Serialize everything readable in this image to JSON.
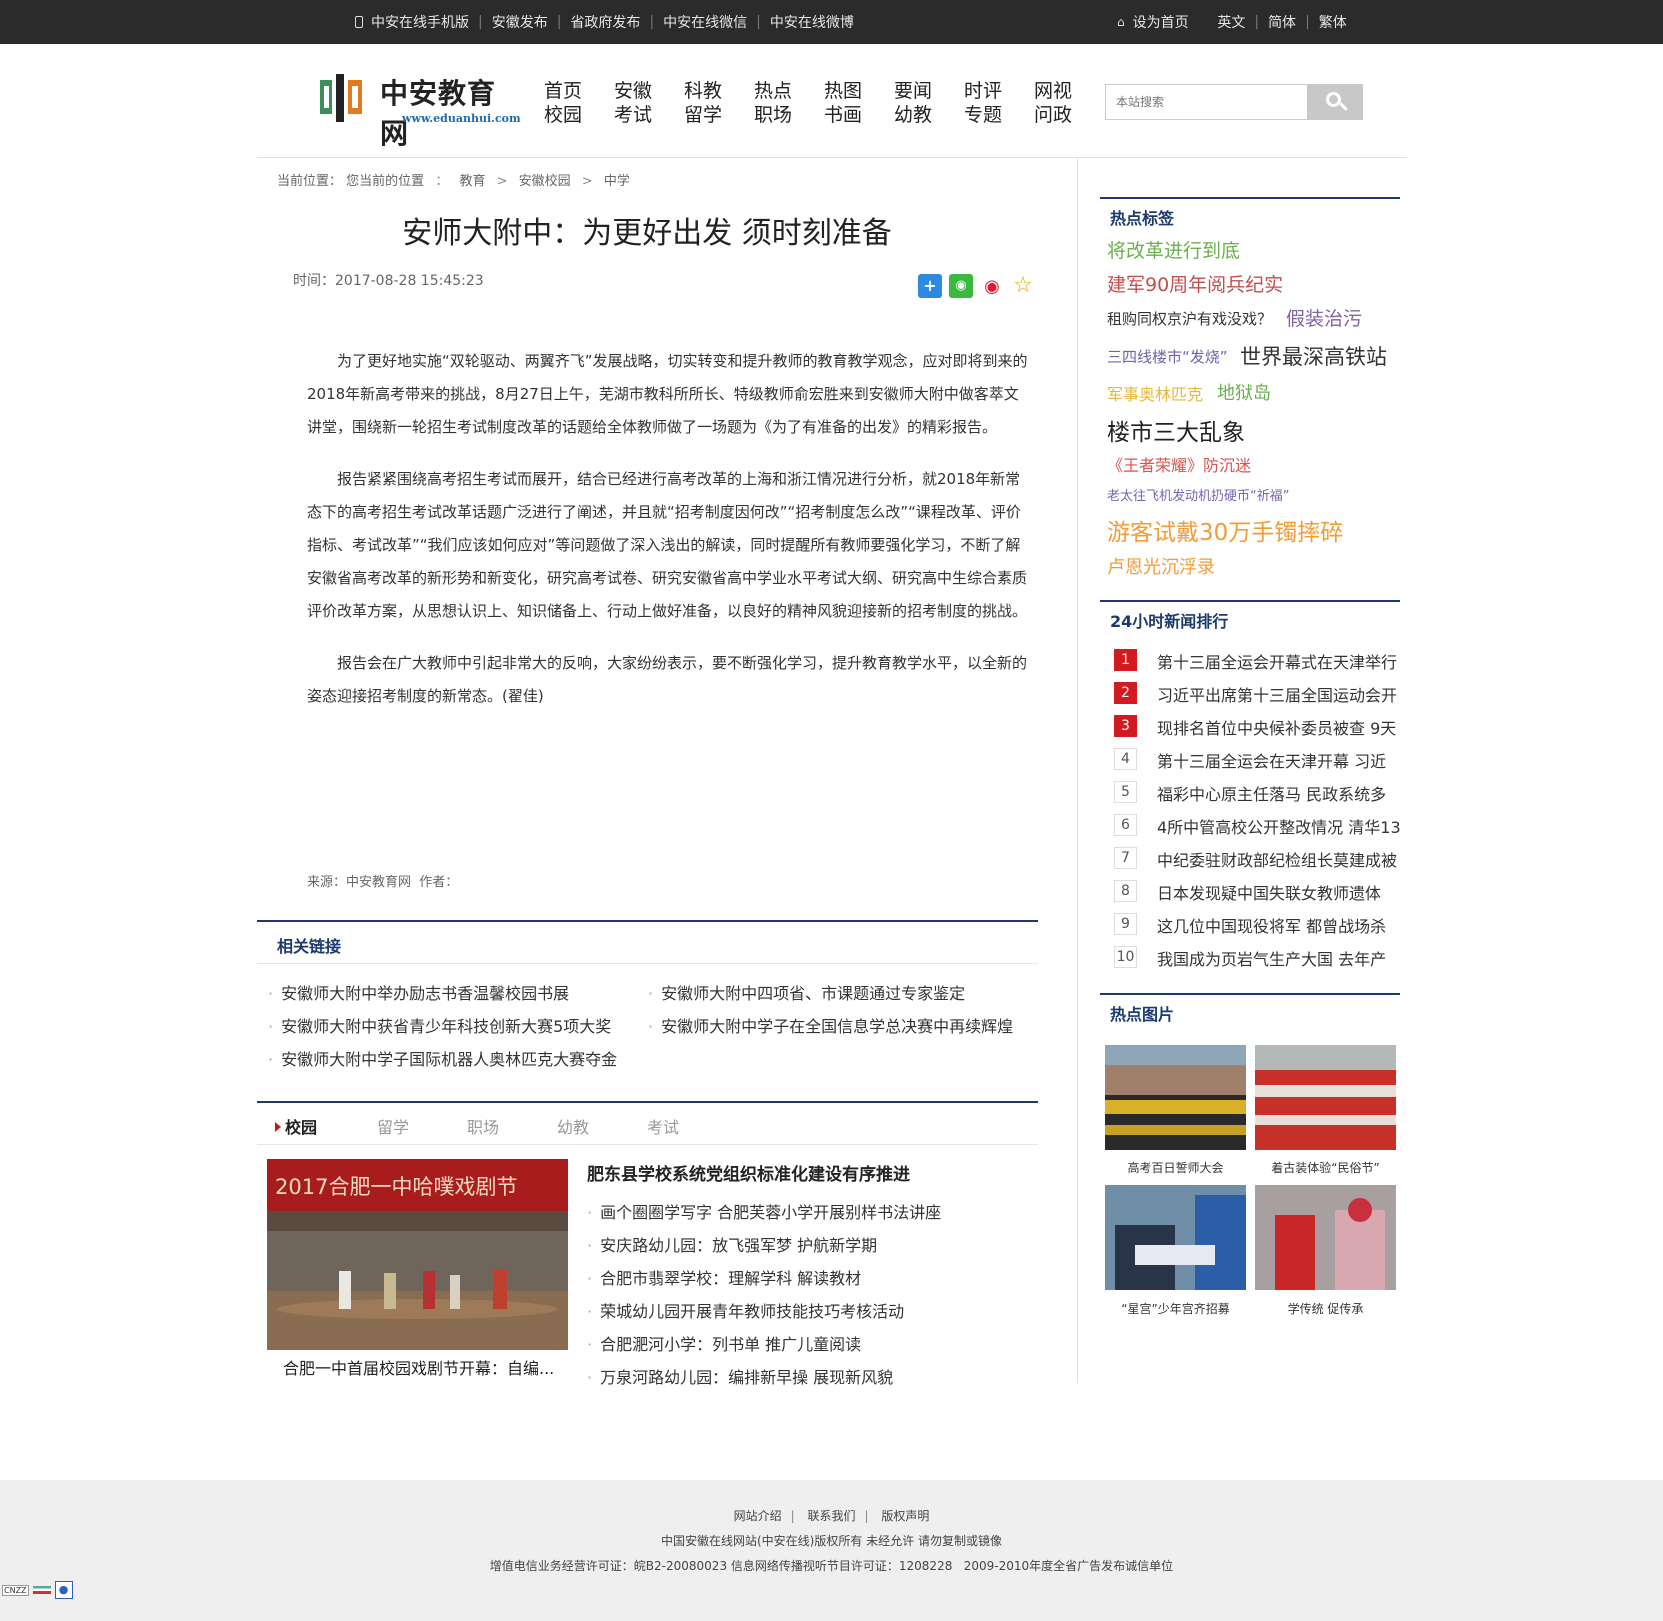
{
  "topbar": {
    "left_links": [
      "中安在线手机版",
      "安徽发布",
      "省政府发布",
      "中安在线微信",
      "中安在线微博"
    ],
    "right_links": [
      "设为首页",
      "英文",
      "简体",
      "繁体"
    ]
  },
  "logo": {
    "text": "中安教育网",
    "url": "www.eduanhui.com"
  },
  "nav": [
    [
      "首页",
      "校园"
    ],
    [
      "安徽",
      "考试"
    ],
    [
      "科教",
      "留学"
    ],
    [
      "热点",
      "职场"
    ],
    [
      "热图",
      "书画"
    ],
    [
      "要闻",
      "幼教"
    ],
    [
      "时评",
      "专题"
    ],
    [
      "网视",
      "问政"
    ]
  ],
  "search": {
    "placeholder": "本站搜索"
  },
  "breadcrumb": {
    "prefix": "当前位置：",
    "here": "您当前的位置",
    "sep1": "：",
    "items": [
      "教育",
      "安徽校园",
      "中学"
    ],
    "sep": ">"
  },
  "article": {
    "title": "安师大附中：为更好出发 须时刻准备",
    "time": "时间：2017-08-28 15:45:23",
    "paragraphs": [
      "为了更好地实施“双轮驱动、两翼齐飞”发展战略，切实转变和提升教师的教育教学观念，应对即将到来的2018年新高考带来的挑战，8月27日上午，芜湖市教科所所长、特级教师俞宏胜来到安徽师大附中做客萃文讲堂，围绕新一轮招生考试制度改革的话题给全体教师做了一场题为《为了有准备的出发》的精彩报告。",
      "报告紧紧围绕高考招生考试而展开，结合已经进行高考改革的上海和浙江情况进行分析，就2018年新常态下的高考招生考试改革话题广泛进行了阐述，并且就“招考制度因何改”“招考制度怎么改”“课程改革、评价指标、考试改革”“我们应该如何应对”等问题做了深入浅出的解读，同时提醒所有教师要强化学习，不断了解安徽省高考改革的新形势和新变化，研究高考试卷、研究安徽省高中学业水平考试大纲、研究高中生综合素质评价改革方案，从思想认识上、知识储备上、行动上做好准备，以良好的精神风貌迎接新的招考制度的挑战。",
      "报告会在广大教师中引起非常大的反响，大家纷纷表示，要不断强化学习，提升教育教学水平，以全新的姿态迎接招考制度的新常态。(翟佳)"
    ],
    "source": "来源：中安教育网  作者："
  },
  "share_icons": [
    "plus-share-icon",
    "wechat-icon",
    "weibo-icon",
    "star-favorite-icon"
  ],
  "related": {
    "title": "相关链接",
    "items": [
      "安徽师大附中举办励志书香温馨校园书展",
      "安徽师大附中四项省、市课题通过专家鉴定",
      "安徽师大附中获省青少年科技创新大赛5项大奖",
      "安徽师大附中学子在全国信息学总决赛中再续辉煌",
      "安徽师大附中学子国际机器人奥林匹克大赛夺金"
    ]
  },
  "tabs": [
    "校园",
    "留学",
    "职场",
    "幼教",
    "考试"
  ],
  "campus": {
    "feature_caption": "合肥一中首届校园戏剧节开幕：自编...",
    "feature_banner": "2017合肥一中哈噗戏剧节",
    "headline": "肥东县学校系统党组织标准化建设有序推进",
    "items": [
      "画个圈圈学写字 合肥芙蓉小学开展别样书法讲座",
      "安庆路幼儿园：放飞强军梦 护航新学期",
      "合肥市翡翠学校：理解学科 解读教材",
      "荣城幼儿园开展青年教师技能技巧考核活动",
      "合肥淝河小学：列书单 推广儿童阅读",
      "万泉河路幼儿园：编排新早操 展现新风貌"
    ]
  },
  "hot_tags": {
    "title": "热点标签",
    "tags": [
      {
        "text": "将改革进行到底",
        "color": "#6ab04c"
      },
      {
        "text": "建军90周年阅兵纪实",
        "color": "#c0504d"
      },
      {
        "text": "租购同权京沪有戏没戏？",
        "color": "#333333"
      },
      {
        "text": "假装治污",
        "color": "#8064a2"
      },
      {
        "text": "三四线楼市“发烧”",
        "color": "#6f63a8"
      },
      {
        "text": "世界最深高铁站",
        "color": "#333333"
      },
      {
        "text": "军事奥林匹克",
        "color": "#e6b83a"
      },
      {
        "text": "地狱岛",
        "color": "#6ab04c"
      },
      {
        "text": "楼市三大乱象",
        "color": "#222222"
      },
      {
        "text": "《王者荣耀》防沉迷",
        "color": "#d9534f"
      },
      {
        "text": "老太往飞机发动机扔硬币“祈福”",
        "color": "#7a62b3"
      },
      {
        "text": "游客试戴30万手镯摔碎",
        "color": "#f39c35"
      },
      {
        "text": "卢恩光沉浮录",
        "color": "#f39c35"
      }
    ]
  },
  "ranking": {
    "title": "24小时新闻排行",
    "items": [
      {
        "n": "1",
        "text": "第十三届全运会开幕式在天津举行"
      },
      {
        "n": "2",
        "text": "习近平出席第十三届全国运动会开"
      },
      {
        "n": "3",
        "text": "现排名首位中央候补委员被查 9天"
      },
      {
        "n": "4",
        "text": "第十三届全运会在天津开幕 习近"
      },
      {
        "n": "5",
        "text": "福彩中心原主任落马 民政系统多"
      },
      {
        "n": "6",
        "text": "4所中管高校公开整改情况 清华13"
      },
      {
        "n": "7",
        "text": "中纪委驻财政部纪检组长莫建成被"
      },
      {
        "n": "8",
        "text": "日本发现疑中国失联女教师遗体"
      },
      {
        "n": "9",
        "text": "这几位中国现役将军 都曾战场杀"
      },
      {
        "n": "10",
        "text": "我国成为页岩气生产大国 去年产"
      }
    ]
  },
  "hot_pics": {
    "title": "热点图片",
    "items": [
      "高考百日誓师大会",
      "着古装体验“民俗节”",
      "“星宫”少年宫齐招募",
      "学传统 促传承"
    ]
  },
  "footer": {
    "links": [
      "网站介绍",
      "联系我们",
      "版权声明"
    ],
    "line2": "中国安徽在线网站(中安在线)版权所有 未经允许 请勿复制或镜像",
    "line3": "增值电信业务经营许可证：皖B2-20080023 信息网络传播视听节目许可证：1208228   2009-2010年度全省广告发布诚信单位",
    "badge": "CNZZ"
  }
}
